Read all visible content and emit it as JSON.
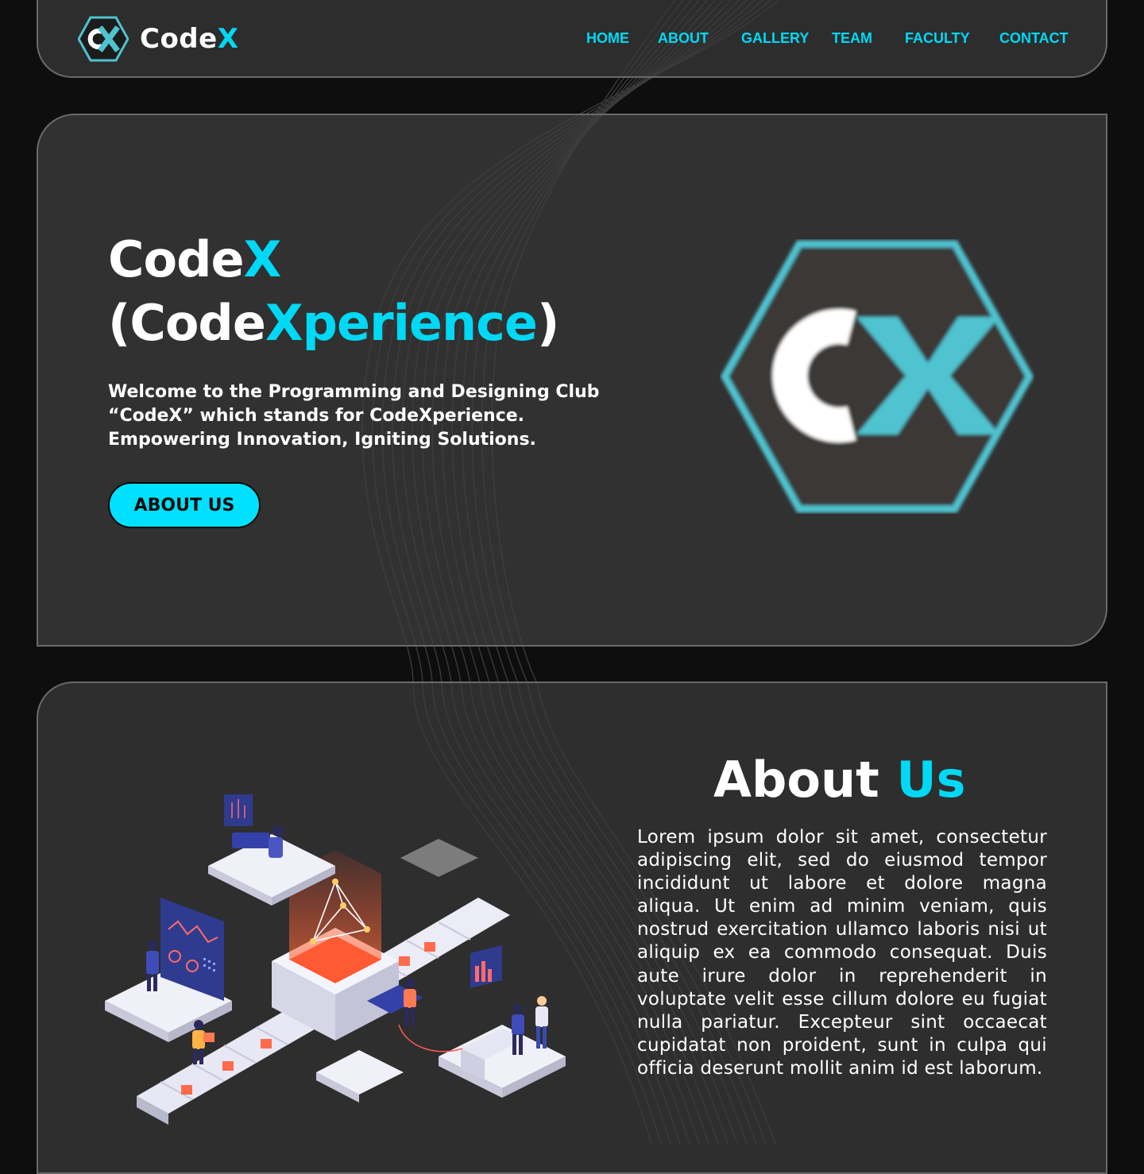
{
  "brand": {
    "name_main": "Code",
    "name_accent": "X",
    "logo_text": "CX"
  },
  "nav": {
    "items": [
      {
        "label": "HOME"
      },
      {
        "label": "ABOUT"
      },
      {
        "label": "GALLERY"
      },
      {
        "label": "TEAM"
      },
      {
        "label": "FACULTY"
      },
      {
        "label": "CONTACT"
      }
    ]
  },
  "hero": {
    "title_line1_main": "Code",
    "title_line1_accent": "X",
    "title_line2_open": "(Code",
    "title_line2_accent": "Xperience",
    "title_line2_close": ")",
    "description": "Welcome to the Programming and Designing Club “CodeX” which stands for CodeXperience. Empowering Innovation, Igniting Solutions.",
    "button_label": "ABOUT US"
  },
  "about": {
    "heading_main": "About ",
    "heading_accent": "Us",
    "body": "Lorem ipsum dolor sit amet, consectetur adipiscing elit, sed do eiusmod tempor incididunt ut labore et dolore magna aliqua. Ut enim ad minim veniam, quis nostrud exercitation ullamco laboris nisi ut aliquip ex ea commodo consequat. Duis aute irure dolor in reprehenderit in voluptate velit esse cillum dolore eu fugiat nulla pariatur. Excepteur sint occaecat cupidatat non proident, sunt in culpa qui officia deserunt mollit anim id est laborum."
  },
  "colors": {
    "accent": "#00d9f5",
    "button_bg": "#00e1ff",
    "logo_teal": "#4fc3d0",
    "page_bg": "#0e0e0e",
    "card_bg": "#3c3c3c"
  }
}
